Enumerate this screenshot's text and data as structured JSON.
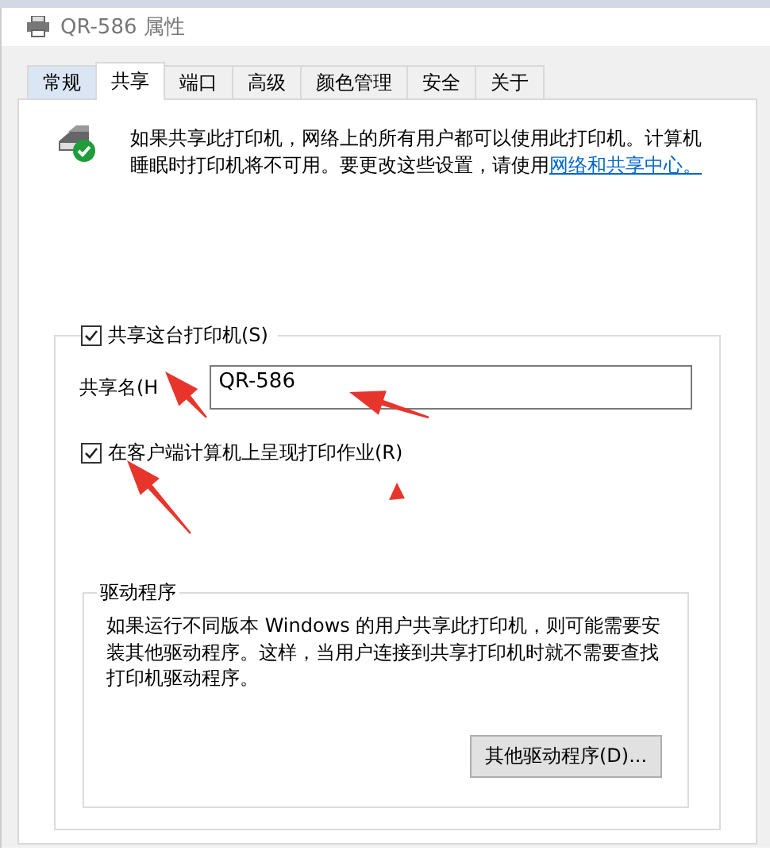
{
  "window": {
    "title": "QR-586 属性"
  },
  "tabs": [
    {
      "label": "常规",
      "selected": false
    },
    {
      "label": "共享",
      "selected": true
    },
    {
      "label": "端口",
      "selected": false
    },
    {
      "label": "高级",
      "selected": false
    },
    {
      "label": "颜色管理",
      "selected": false
    },
    {
      "label": "安全",
      "selected": false
    },
    {
      "label": "关于",
      "selected": false
    }
  ],
  "info": {
    "text": "如果共享此打印机，网络上的所有用户都可以使用此打印机。计算机睡眠时打印机将不可用。要更改这些设置，请使用",
    "link": "网络和共享中心。"
  },
  "share_checkbox": {
    "label": "共享这台打印机(S)",
    "checked": true
  },
  "share_name": {
    "label": "共享名(H",
    "value": "QR-586"
  },
  "render_checkbox": {
    "label": "在客户端计算机上呈现打印作业(R)",
    "checked": true
  },
  "drivers": {
    "title": "驱动程序",
    "text": "如果运行不同版本 Windows 的用户共享此打印机，则可能需要安装其他驱动程序。这样，当用户连接到共享打印机时就不需要查找打印机驱动程序。",
    "button": "其他驱动程序(D)..."
  }
}
